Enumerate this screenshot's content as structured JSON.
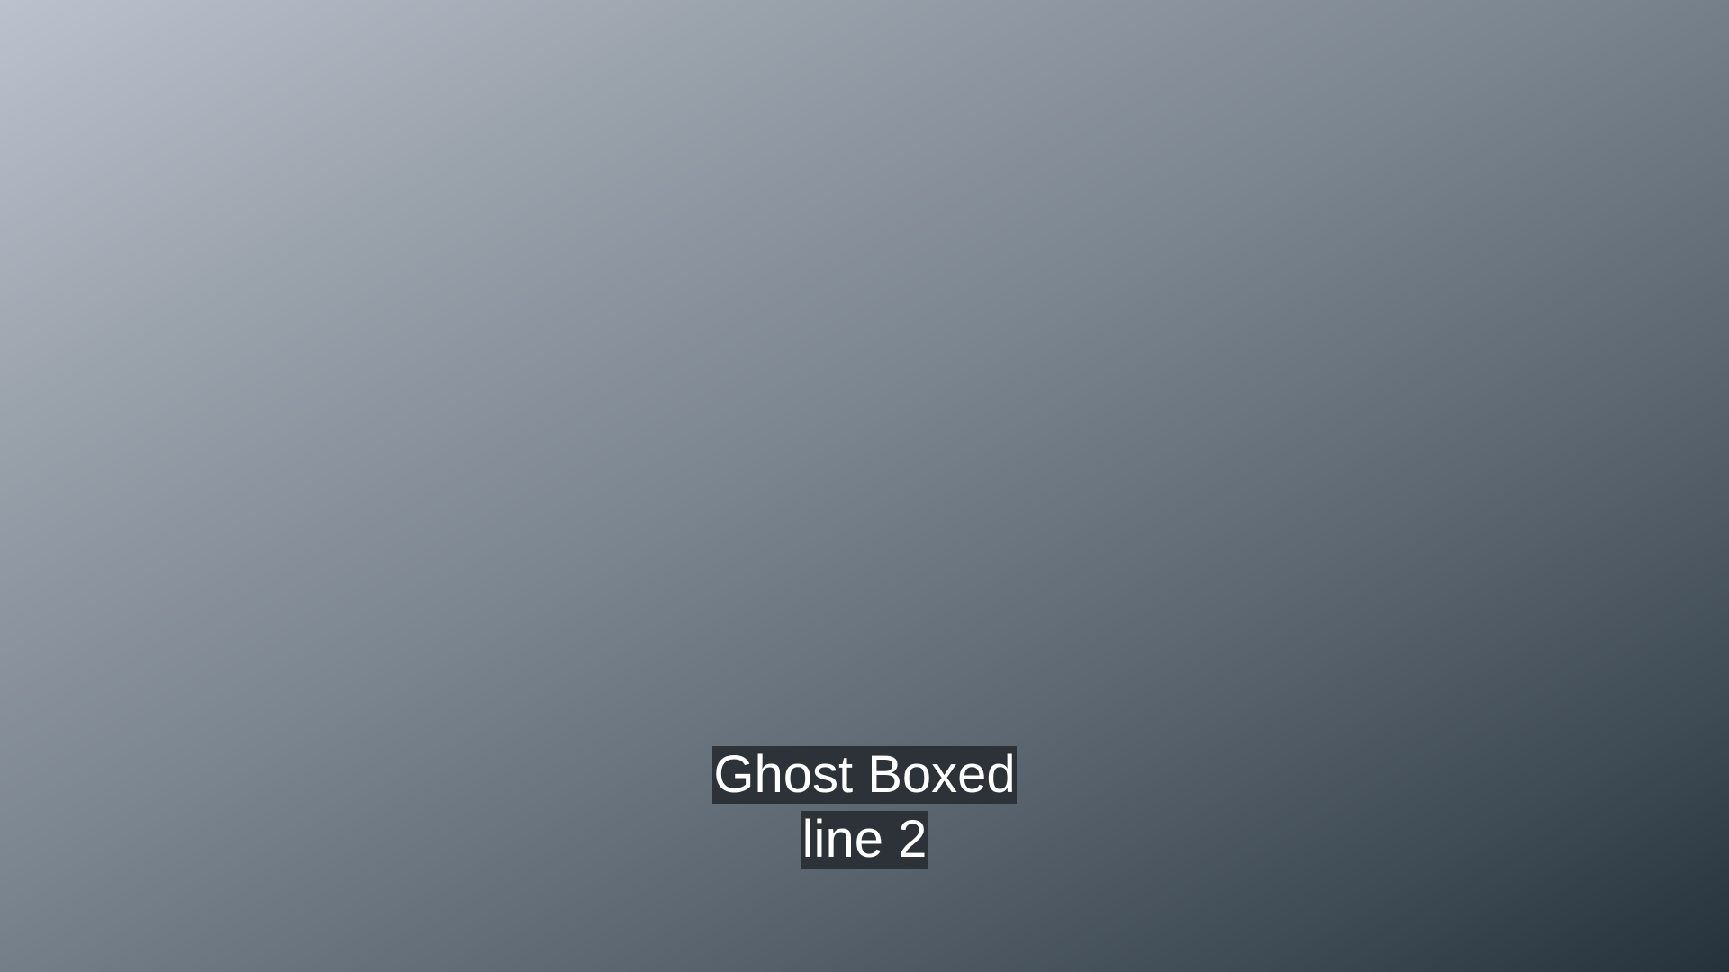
{
  "colors": {
    "background_top_left": "#bcc2cd",
    "background_bottom_right": "#26323b",
    "caption_box": "#292f34",
    "caption_text": "#ffffff"
  },
  "caption": {
    "lines": [
      "Ghost Boxed",
      "line 2"
    ]
  }
}
